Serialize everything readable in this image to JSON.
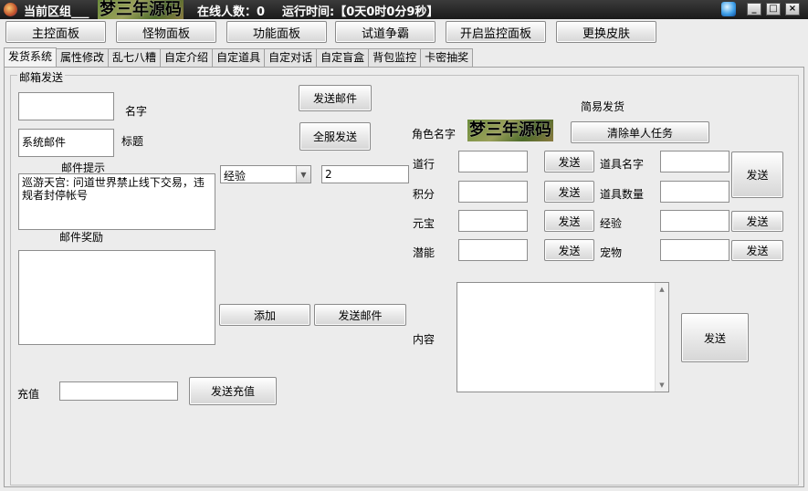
{
  "title": {
    "zone_label": "当前区组___",
    "logo_text": "梦三年源码",
    "online_label": "在线人数：0",
    "runtime_label": "运行时间:【0天0时0分9秒】"
  },
  "window_buttons": {
    "minimize": "_",
    "maximize": "□",
    "close": "×"
  },
  "panel_buttons": [
    "主控面板",
    "怪物面板",
    "功能面板",
    "试道争霸",
    "开启监控面板",
    "更换皮肤"
  ],
  "tabs": [
    "发货系统",
    "属性修改",
    "乱七八糟",
    "自定介绍",
    "自定道具",
    "自定对话",
    "自定盲盒",
    "背包监控",
    "卡密抽奖"
  ],
  "mail": {
    "group_title": "邮箱发送",
    "name_value": "",
    "name_label": "名字",
    "title_value": "系统邮件",
    "title_label": "标题",
    "hint_label": "邮件提示",
    "hint_text": "巡游天宫: 问道世界禁止线下交易，违规者封停帐号",
    "reward_label": "邮件奖励",
    "reward_text": "",
    "send_mail_btn": "发送邮件",
    "send_all_btn": "全服发送",
    "combo_value": "经验",
    "amount_value": "2",
    "add_btn": "添加",
    "send_mail_btn2": "发送邮件",
    "recharge_label": "充值",
    "recharge_value": "",
    "recharge_btn": "发送充值"
  },
  "quick": {
    "title": "简易发货",
    "role_label": "角色名字",
    "logo_text": "梦三年源码",
    "clear_task_btn": "清除单人任务",
    "daoxing_label": "道行",
    "jifen_label": "积分",
    "yuanbao_label": "元宝",
    "qianneng_label": "潜能",
    "send_label": "发送",
    "item_name_label": "道具名字",
    "item_count_label": "道具数量",
    "exp_label": "经验",
    "pet_label": "宠物",
    "content_label": "内容",
    "content_value": ""
  }
}
